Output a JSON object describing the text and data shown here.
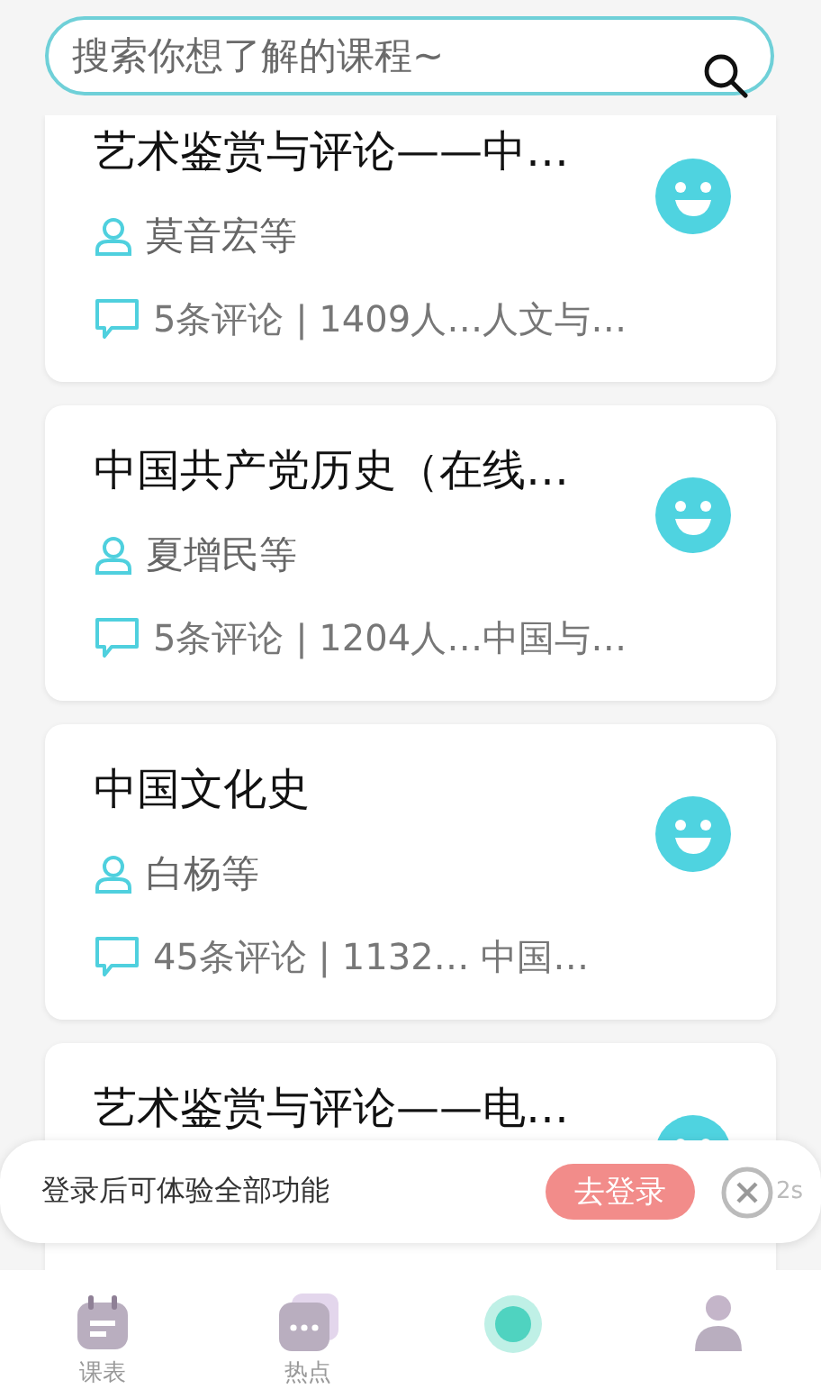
{
  "search": {
    "placeholder": "搜索你想了解的课程~"
  },
  "courses": [
    {
      "title": "艺术鉴赏与评论——中…",
      "teacher": "莫音宏等",
      "stats": "5条评论 | 1409人…人文与…"
    },
    {
      "title": "中国共产党历史（在线…",
      "teacher": "夏增民等",
      "stats": "5条评论 | 1204人…中国与…"
    },
    {
      "title": "中国文化史",
      "teacher": "白杨等",
      "stats": "45条评论 | 1132…  中国…"
    },
    {
      "title": "艺术鉴赏与评论——电…"
    }
  ],
  "toast": {
    "message": "登录后可体验全部功能",
    "login_button": "去登录",
    "countdown": "2s"
  },
  "nav": [
    {
      "kind": "schedule",
      "label": "课表",
      "selected": false
    },
    {
      "kind": "hot",
      "label": "热点",
      "selected": false
    },
    {
      "kind": "learn",
      "selected": true
    },
    {
      "kind": "me",
      "selected": false
    }
  ]
}
